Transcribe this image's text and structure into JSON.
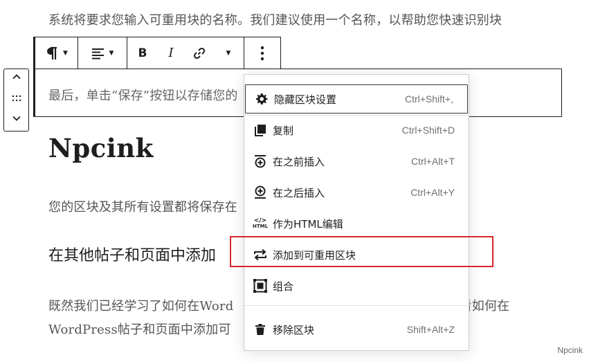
{
  "content": {
    "para_top": "系统将要求您输入可重用块的名称。我们建议使用一个名称，以帮助您快速识别块",
    "para_selected": "最后，单击“保存”按钮以存储您的",
    "heading_main": "Npcink",
    "para_saved": "您的区块及其所有设置都将保存在",
    "heading_sub": "在其他帖子和页面中添加",
    "para_bottom_1": "既然我们已经学习了如何在Word                                                    看看如何在",
    "para_bottom_2": "WordPress帖子和页面中添加可"
  },
  "toolbar": {
    "paragraph_icon": "pilcrow-icon",
    "align_icon": "align-left-icon",
    "bold_label": "B",
    "italic_label": "I",
    "link_icon": "link-icon",
    "more_icon": "vertical-ellipsis-icon"
  },
  "mover": {
    "up_icon": "chevron-up-icon",
    "drag_icon": "drag-handle-icon",
    "down_icon": "chevron-down-icon"
  },
  "menu": {
    "items": [
      {
        "label": "隐藏区块设置",
        "shortcut": "Ctrl+Shift+,",
        "icon": "gear-icon"
      },
      {
        "label": "复制",
        "shortcut": "Ctrl+Shift+D",
        "icon": "duplicate-icon"
      },
      {
        "label": "在之前插入",
        "shortcut": "Ctrl+Alt+T",
        "icon": "insert-before-icon"
      },
      {
        "label": "在之后插入",
        "shortcut": "Ctrl+Alt+Y",
        "icon": "insert-after-icon"
      },
      {
        "label": "作为HTML编辑",
        "shortcut": "",
        "icon": "html-icon"
      },
      {
        "label": "添加到可重用区块",
        "shortcut": "",
        "icon": "reusable-icon"
      },
      {
        "label": "组合",
        "shortcut": "",
        "icon": "group-icon"
      },
      {
        "label": "移除区块",
        "shortcut": "Shift+Alt+Z",
        "icon": "trash-icon"
      }
    ]
  },
  "html_icon_text": "HTML",
  "watermark": "Npcink",
  "colors": {
    "highlight": "#d9272e",
    "text_dark": "#1e1e1e"
  }
}
